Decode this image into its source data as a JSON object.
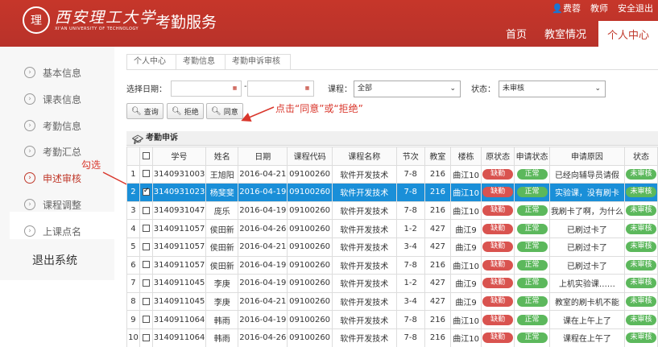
{
  "header": {
    "logo_cn": "西安理工大学",
    "logo_en": "XI'AN UNIVERSITY OF TECHNOLOGY",
    "app_title": "考勤服务",
    "user": "费蓉",
    "role": "教师",
    "logout_top": "安全退出",
    "nav": [
      "首页",
      "教室情况",
      "个人中心"
    ],
    "active_nav": "个人中心"
  },
  "sidebar": {
    "items": [
      {
        "label": "基本信息"
      },
      {
        "label": "课表信息"
      },
      {
        "label": "考勤信息"
      },
      {
        "label": "考勤汇总"
      },
      {
        "label": "申述审核"
      },
      {
        "label": "课程调整"
      },
      {
        "label": "上课点名"
      }
    ],
    "active": "申述审核",
    "logout": "退出系统"
  },
  "breadcrumb": [
    "个人中心",
    "考勤信息",
    "考勤申诉审核"
  ],
  "filters": {
    "date_label": "选择日期：",
    "date_sep": "-",
    "date_from": "",
    "date_to": "",
    "course_label": "课程：",
    "course_value": "全部",
    "status_label": "状态：",
    "status_value": "未审核"
  },
  "buttons": {
    "query": "查询",
    "reject": "拒绝",
    "approve": "同意"
  },
  "annotations": {
    "hint": "点击“同意”或“拒绝”",
    "check": "勾选"
  },
  "panel_title": "考勤申诉",
  "colors": {
    "brand": "#c0392b",
    "selected_row": "#1a8fd8",
    "absent_pill": "#d9534f",
    "normal_pill": "#5cb85c",
    "annotation": "#d9362b"
  },
  "table": {
    "headers": [
      "",
      "",
      "学号",
      "姓名",
      "日期",
      "课程代码",
      "课程名称",
      "节次",
      "教室",
      "楼栋",
      "原状态",
      "申请状态",
      "申请原因",
      "状态"
    ],
    "rows": [
      {
        "no": "1",
        "checked": false,
        "id": "3140931003",
        "name": "王旭阳",
        "date": "2016-04-21",
        "code": "09100260",
        "course": "软件开发技术",
        "period": "7-8",
        "room": "216",
        "building": "曲江10",
        "orig": "缺勤",
        "apply": "正常",
        "reason": "已经向辅导员请假",
        "status": "未审核"
      },
      {
        "no": "2",
        "checked": true,
        "id": "3140931023",
        "name": "杨斐斐",
        "date": "2016-04-19",
        "code": "09100260",
        "course": "软件开发技术",
        "period": "7-8",
        "room": "216",
        "building": "曲江10",
        "orig": "缺勤",
        "apply": "正常",
        "reason": "实验课，没有刷卡",
        "status": "未审核"
      },
      {
        "no": "3",
        "checked": false,
        "id": "3140931047",
        "name": "庞乐",
        "date": "2016-04-19",
        "code": "09100260",
        "course": "软件开发技术",
        "period": "7-8",
        "room": "216",
        "building": "曲江10",
        "orig": "缺勤",
        "apply": "正常",
        "reason": "我刷卡了啊，为什么",
        "status": "未审核"
      },
      {
        "no": "4",
        "checked": false,
        "id": "3140911057",
        "name": "侯田新",
        "date": "2016-04-26",
        "code": "09100260",
        "course": "软件开发技术",
        "period": "1-2",
        "room": "427",
        "building": "曲江9",
        "orig": "缺勤",
        "apply": "正常",
        "reason": "已刷过卡了",
        "status": "未审核"
      },
      {
        "no": "5",
        "checked": false,
        "id": "3140911057",
        "name": "侯田新",
        "date": "2016-04-21",
        "code": "09100260",
        "course": "软件开发技术",
        "period": "3-4",
        "room": "427",
        "building": "曲江9",
        "orig": "缺勤",
        "apply": "正常",
        "reason": "已刷过卡了",
        "status": "未审核"
      },
      {
        "no": "6",
        "checked": false,
        "id": "3140911057",
        "name": "侯田新",
        "date": "2016-04-19",
        "code": "09100260",
        "course": "软件开发技术",
        "period": "7-8",
        "room": "216",
        "building": "曲江10",
        "orig": "缺勤",
        "apply": "正常",
        "reason": "已刷过卡了",
        "status": "未审核"
      },
      {
        "no": "7",
        "checked": false,
        "id": "3140911045",
        "name": "李庚",
        "date": "2016-04-19",
        "code": "09100260",
        "course": "软件开发技术",
        "period": "1-2",
        "room": "427",
        "building": "曲江9",
        "orig": "缺勤",
        "apply": "正常",
        "reason": "上机实验课……",
        "status": "未审核"
      },
      {
        "no": "8",
        "checked": false,
        "id": "3140911045",
        "name": "李庚",
        "date": "2016-04-21",
        "code": "09100260",
        "course": "软件开发技术",
        "period": "3-4",
        "room": "427",
        "building": "曲江9",
        "orig": "缺勤",
        "apply": "正常",
        "reason": "教室的刷卡机不能",
        "status": "未审核"
      },
      {
        "no": "9",
        "checked": false,
        "id": "3140911064",
        "name": "韩雨",
        "date": "2016-04-19",
        "code": "09100260",
        "course": "软件开发技术",
        "period": "7-8",
        "room": "216",
        "building": "曲江10",
        "orig": "缺勤",
        "apply": "正常",
        "reason": "课在上午上了",
        "status": "未审核"
      },
      {
        "no": "10",
        "checked": false,
        "id": "3140911064",
        "name": "韩雨",
        "date": "2016-04-26",
        "code": "09100260",
        "course": "软件开发技术",
        "period": "7-8",
        "room": "216",
        "building": "曲江10",
        "orig": "缺勤",
        "apply": "正常",
        "reason": "课程在上午了",
        "status": "未审核"
      }
    ]
  }
}
